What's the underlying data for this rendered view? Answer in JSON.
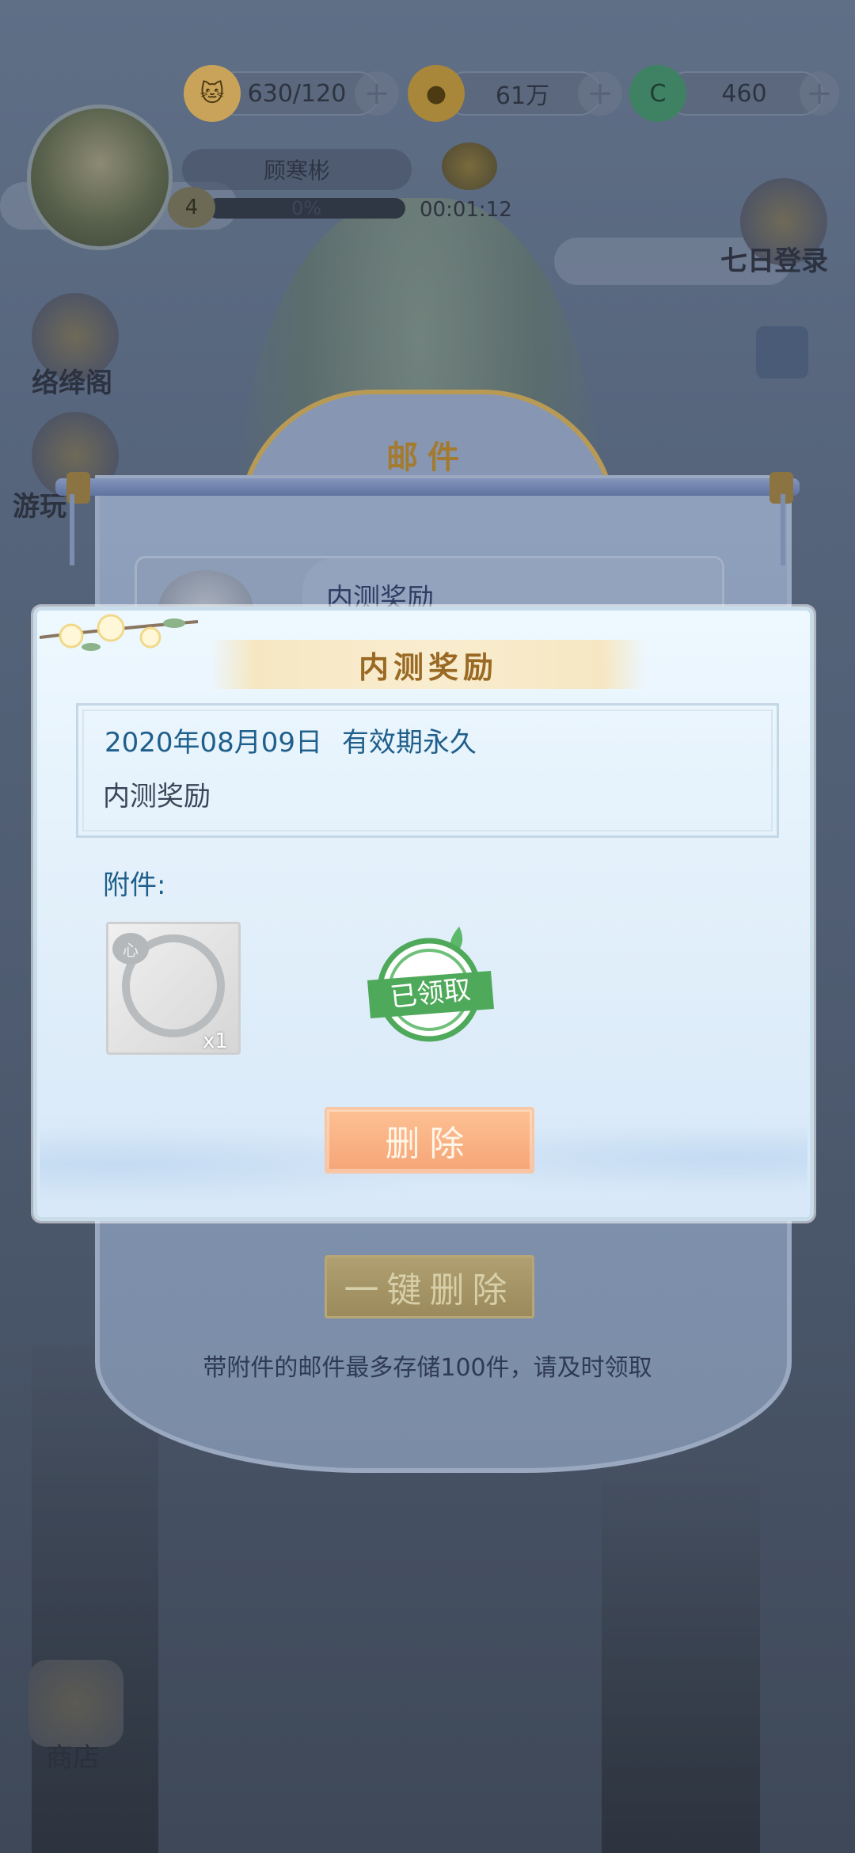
{
  "resources": {
    "stamina": "630/120",
    "coins": "61万",
    "jade": "460",
    "plus": "+"
  },
  "player": {
    "name": "顾寒彬",
    "level": "4",
    "exp": "0%",
    "timer": "00:01:12"
  },
  "side_menu": {
    "left_top": "络绛阁",
    "left_mid": "游玩",
    "right_top": "七日登录",
    "shop": "商店"
  },
  "mail": {
    "title": "邮件",
    "item_title": "内测奖励",
    "delete_all_label": "一键删除",
    "storage_note": "带附件的邮件最多存储100件，请及时领取"
  },
  "dialog": {
    "title": "内测奖励",
    "date": "2020年08月09日",
    "expiry": "有效期永久",
    "body": "内测奖励",
    "attachments_label": "附件:",
    "attachment": {
      "name": "心",
      "count": "x1"
    },
    "claimed_stamp": "已领取",
    "delete_label": "删除"
  },
  "colors": {
    "dialog_title": "#9a6a24",
    "accent_blue": "#1f5f8b",
    "delete_button": "#f6a577",
    "stamp_green": "#4fa95a"
  }
}
